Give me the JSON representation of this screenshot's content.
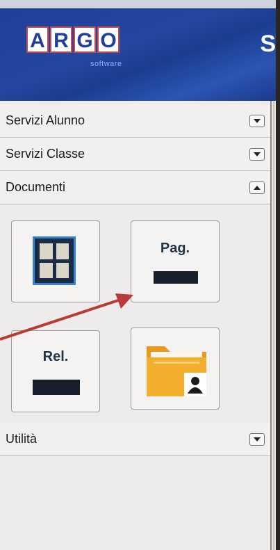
{
  "header": {
    "logo_letters": [
      "A",
      "R",
      "G",
      "O"
    ],
    "logo_sub": "software",
    "cut_title": "S"
  },
  "sidebar": {
    "sections": [
      {
        "label": "Servizi Alunno",
        "state": "collapsed"
      },
      {
        "label": "Servizi Classe",
        "state": "collapsed"
      },
      {
        "label": "Documenti",
        "state": "expanded"
      },
      {
        "label": "Utilità",
        "state": "collapsed"
      }
    ],
    "tiles": [
      {
        "label": "",
        "icon": "registro-grid-icon"
      },
      {
        "label": "Pag.",
        "icon": "pagella-icon"
      },
      {
        "label": "Rel.",
        "icon": "relazione-icon"
      },
      {
        "label": "",
        "icon": "student-folder-icon"
      }
    ]
  },
  "colors": {
    "header_blue": "#1f3f9a",
    "annotation_arrow": "#b83a3a",
    "folder_orange": "#f0a020"
  }
}
